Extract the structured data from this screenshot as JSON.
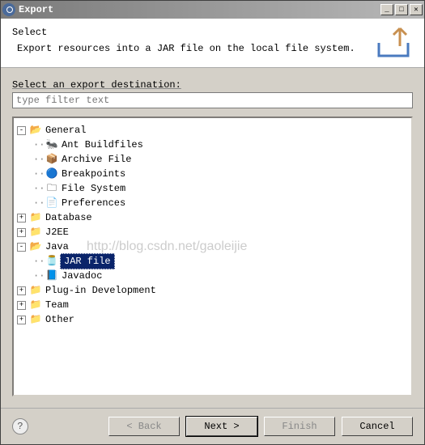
{
  "window": {
    "title": "Export"
  },
  "header": {
    "title": "Select",
    "description": "Export resources into a JAR file on the local file system."
  },
  "destination": {
    "label": "Select an export destination:",
    "filter_placeholder": "type filter text"
  },
  "tree": {
    "nodes": [
      {
        "level": 0,
        "expand": "-",
        "icon": "folder-open",
        "label": "General",
        "selected": false
      },
      {
        "level": 1,
        "expand": "",
        "icon": "ant",
        "label": "Ant Buildfiles",
        "selected": false
      },
      {
        "level": 1,
        "expand": "",
        "icon": "archive",
        "label": "Archive File",
        "selected": false
      },
      {
        "level": 1,
        "expand": "",
        "icon": "breakpoint",
        "label": "Breakpoints",
        "selected": false
      },
      {
        "level": 1,
        "expand": "",
        "icon": "filesystem",
        "label": "File System",
        "selected": false
      },
      {
        "level": 1,
        "expand": "",
        "icon": "preferences",
        "label": "Preferences",
        "selected": false
      },
      {
        "level": 0,
        "expand": "+",
        "icon": "folder",
        "label": "Database",
        "selected": false
      },
      {
        "level": 0,
        "expand": "+",
        "icon": "folder",
        "label": "J2EE",
        "selected": false
      },
      {
        "level": 0,
        "expand": "-",
        "icon": "folder-open",
        "label": "Java",
        "selected": false
      },
      {
        "level": 1,
        "expand": "",
        "icon": "jar",
        "label": "JAR file",
        "selected": true
      },
      {
        "level": 1,
        "expand": "",
        "icon": "javadoc",
        "label": "Javadoc",
        "selected": false
      },
      {
        "level": 0,
        "expand": "+",
        "icon": "folder",
        "label": "Plug-in Development",
        "selected": false
      },
      {
        "level": 0,
        "expand": "+",
        "icon": "folder",
        "label": "Team",
        "selected": false
      },
      {
        "level": 0,
        "expand": "+",
        "icon": "folder",
        "label": "Other",
        "selected": false
      }
    ]
  },
  "watermark": "http://blog.csdn.net/gaoleijie",
  "buttons": {
    "back": "< Back",
    "next": "Next >",
    "finish": "Finish",
    "cancel": "Cancel"
  },
  "icons": {
    "folder-open": "📂",
    "folder": "📁",
    "ant": "🐜",
    "archive": "📦",
    "breakpoint": "🔵",
    "filesystem": "🗀",
    "preferences": "📄",
    "jar": "🫙",
    "javadoc": "📘"
  }
}
